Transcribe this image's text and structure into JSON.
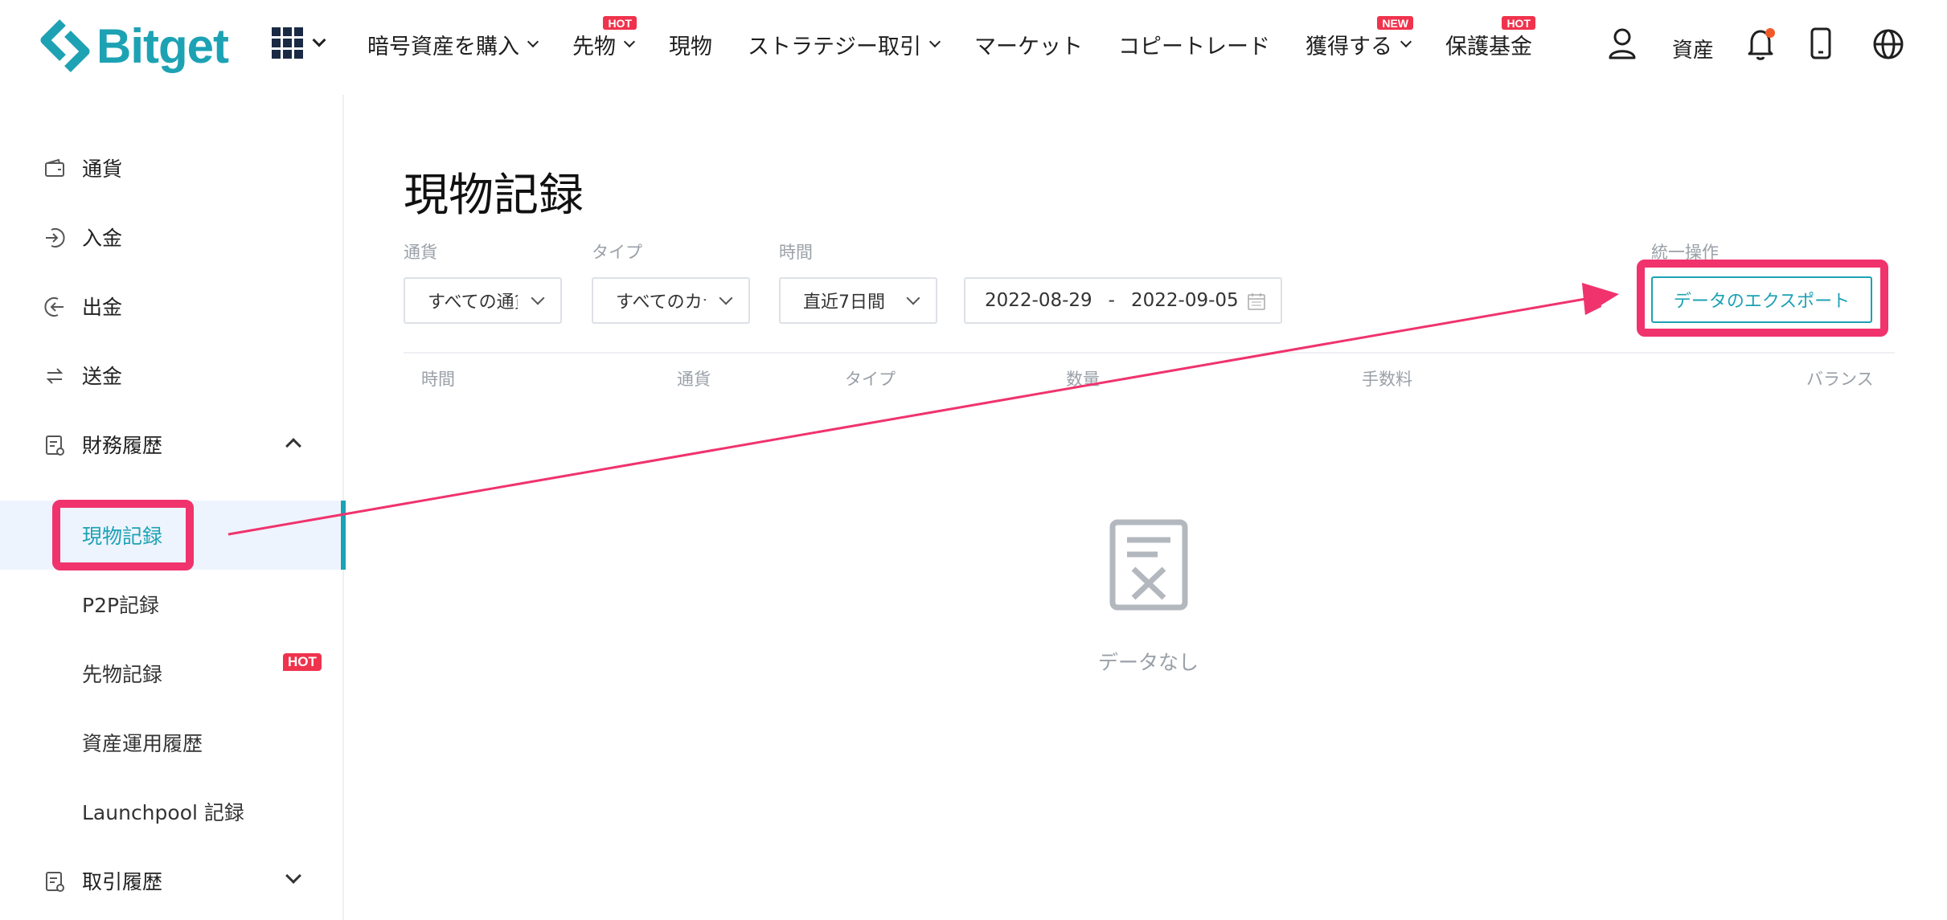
{
  "header": {
    "logo_text": "Bitget",
    "nav": [
      {
        "label": "暗号資産を購入",
        "dropdown": true,
        "badge": ""
      },
      {
        "label": "先物",
        "dropdown": true,
        "badge": "HOT"
      },
      {
        "label": "現物",
        "dropdown": false,
        "badge": ""
      },
      {
        "label": "ストラテジー取引",
        "dropdown": true,
        "badge": ""
      },
      {
        "label": "マーケット",
        "dropdown": false,
        "badge": ""
      },
      {
        "label": "コピートレード",
        "dropdown": false,
        "badge": ""
      },
      {
        "label": "獲得する",
        "dropdown": true,
        "badge": "NEW"
      },
      {
        "label": "保護基金",
        "dropdown": false,
        "badge": "HOT"
      }
    ],
    "assets_label": "資産",
    "icons": [
      "apps-grid-icon",
      "user-icon",
      "bell-icon",
      "phone-icon",
      "globe-icon"
    ]
  },
  "sidebar": {
    "items": [
      {
        "label": "通貨",
        "icon": "wallet-icon"
      },
      {
        "label": "入金",
        "icon": "deposit-icon"
      },
      {
        "label": "出金",
        "icon": "withdraw-icon"
      },
      {
        "label": "送金",
        "icon": "transfer-icon"
      },
      {
        "label": "財務履歴",
        "icon": "document-icon",
        "expanded": true
      }
    ],
    "sub_items": [
      {
        "label": "現物記録",
        "active": true
      },
      {
        "label": "P2P記録"
      },
      {
        "label": "先物記録",
        "badge": "HOT"
      },
      {
        "label": "資産運用履歴"
      },
      {
        "label": "Launchpool 記録"
      }
    ],
    "trade_history": {
      "label": "取引履歴",
      "icon": "document-icon",
      "expanded": false
    }
  },
  "main": {
    "title": "現物記録",
    "filters": {
      "currency": {
        "label": "通貨",
        "value": "すべての通貨"
      },
      "type": {
        "label": "タイプ",
        "value": "すべてのカテゴリ"
      },
      "time": {
        "label": "時間",
        "value": "直近7日間"
      },
      "date_start": "2022-08-29",
      "date_sep": "-",
      "date_end": "2022-09-05"
    },
    "bulk": {
      "label": "統一操作",
      "export_label": "データのエクスポート"
    },
    "table_headers": [
      "時間",
      "通貨",
      "タイプ",
      "数量",
      "手数料",
      "バランス"
    ],
    "empty_text": "データなし"
  },
  "colors": {
    "brand": "#1da2b4",
    "highlight": "#f0336d",
    "hot": "#f0334d"
  }
}
